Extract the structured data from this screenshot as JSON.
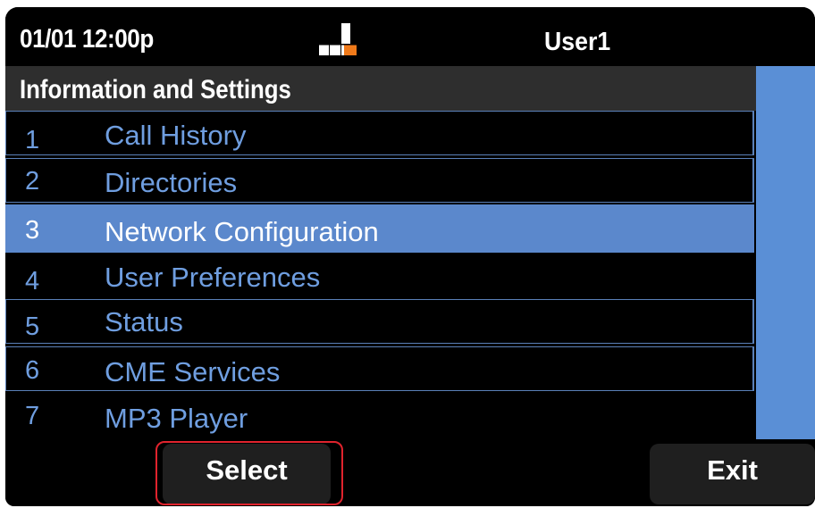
{
  "status_bar": {
    "datetime": "01/01 12:00p",
    "user": "User1",
    "line_icon": "line-status-icon"
  },
  "header": {
    "title": "Information and Settings"
  },
  "menu": {
    "items": [
      {
        "number": "1",
        "label": "Call History"
      },
      {
        "number": "2",
        "label": "Directories"
      },
      {
        "number": "3",
        "label": "Network Configuration"
      },
      {
        "number": "4",
        "label": "User Preferences"
      },
      {
        "number": "5",
        "label": "Status"
      },
      {
        "number": "6",
        "label": "CME Services"
      },
      {
        "number": "7",
        "label": "MP3 Player"
      }
    ],
    "selected_number": "3"
  },
  "softkeys": {
    "select": "Select",
    "exit": "Exit"
  },
  "colors": {
    "accent": "#5b88cc",
    "menu_text": "#6f9ee0",
    "scrollbar": "#5a8fd6",
    "highlight": "#e0232d",
    "icon_orange": "#f07a1a"
  }
}
